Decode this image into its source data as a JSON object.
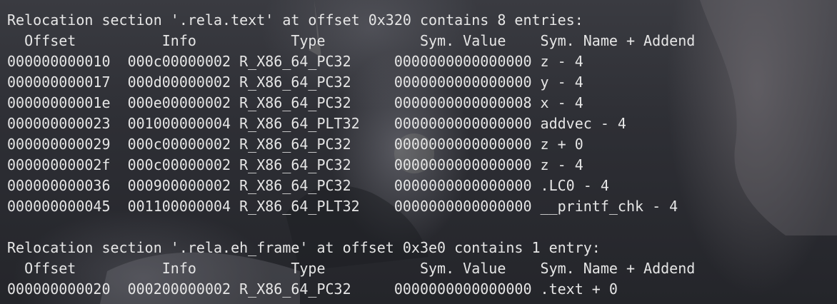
{
  "terminal": {
    "lines": [
      "Relocation section '.rela.text' at offset 0x320 contains 8 entries:",
      "  Offset          Info           Type           Sym. Value    Sym. Name + Addend",
      "000000000010  000c00000002 R_X86_64_PC32     0000000000000000 z - 4",
      "000000000017  000d00000002 R_X86_64_PC32     0000000000000000 y - 4",
      "00000000001e  000e00000002 R_X86_64_PC32     0000000000000008 x - 4",
      "000000000023  001000000004 R_X86_64_PLT32    0000000000000000 addvec - 4",
      "000000000029  000c00000002 R_X86_64_PC32     0000000000000000 z + 0",
      "00000000002f  000c00000002 R_X86_64_PC32     0000000000000000 z - 4",
      "000000000036  000900000002 R_X86_64_PC32     0000000000000000 .LC0 - 4",
      "000000000045  001100000004 R_X86_64_PLT32    0000000000000000 __printf_chk - 4",
      "",
      "Relocation section '.rela.eh_frame' at offset 0x3e0 contains 1 entry:",
      "  Offset          Info           Type           Sym. Value    Sym. Name + Addend",
      "000000000020  000200000002 R_X86_64_PC32     0000000000000000 .text + 0"
    ]
  },
  "colors": {
    "text": "#e6e6e6",
    "background": "#2b2c31"
  }
}
